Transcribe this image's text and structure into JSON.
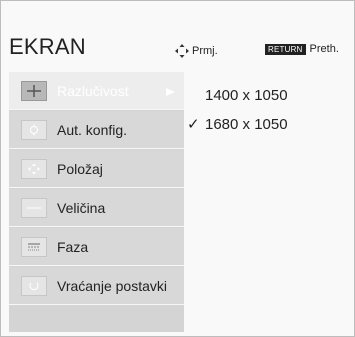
{
  "osd": {
    "title": "EKRAN",
    "hints": {
      "move_label": "Prmj.",
      "return_key": "RETURN",
      "return_label": "Preth."
    }
  },
  "menu": {
    "items": [
      {
        "label": "Razlučivost",
        "icon": "crosshair-icon",
        "active": true
      },
      {
        "label": "Aut. konfig.",
        "icon": "auto-config-icon",
        "active": false
      },
      {
        "label": "Položaj",
        "icon": "position-icon",
        "active": false
      },
      {
        "label": "Veličina",
        "icon": "size-icon",
        "active": false
      },
      {
        "label": "Faza",
        "icon": "phase-icon",
        "active": false
      },
      {
        "label": "Vraćanje postavki",
        "icon": "reset-icon",
        "active": false
      }
    ]
  },
  "resolution_options": [
    {
      "value": "1400 x 1050",
      "selected": false
    },
    {
      "value": "1680 x 1050",
      "selected": true
    }
  ],
  "selected_mark": "✓"
}
